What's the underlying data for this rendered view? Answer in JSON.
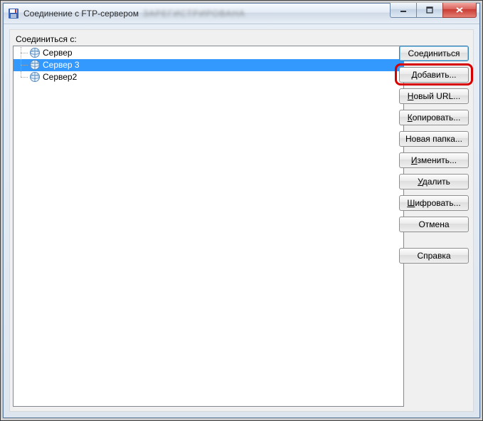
{
  "window": {
    "title": "Соединение с FTP-сервером",
    "blurred_suffix": "ЗАРЕГИСТРИРОВАНА"
  },
  "label": {
    "connect_to": "Соединиться с:"
  },
  "tree": {
    "items": [
      {
        "label": "Сервер",
        "selected": false,
        "last": false
      },
      {
        "label": "Сервер 3",
        "selected": true,
        "last": false
      },
      {
        "label": "Сервер2",
        "selected": false,
        "last": true
      }
    ]
  },
  "buttons": {
    "connect": "Соединиться",
    "add": "Добавить...",
    "new_url_1": "Н",
    "new_url_2": "овый URL...",
    "copy_1": "К",
    "copy_2": "опировать...",
    "new_folder": "Новая папка...",
    "edit_1": "И",
    "edit_2": "зменить...",
    "delete_1": "У",
    "delete_2": "далить",
    "encrypt_1": "Ш",
    "encrypt_2": "ифровать...",
    "cancel": "Отмена",
    "help": "Справка"
  }
}
